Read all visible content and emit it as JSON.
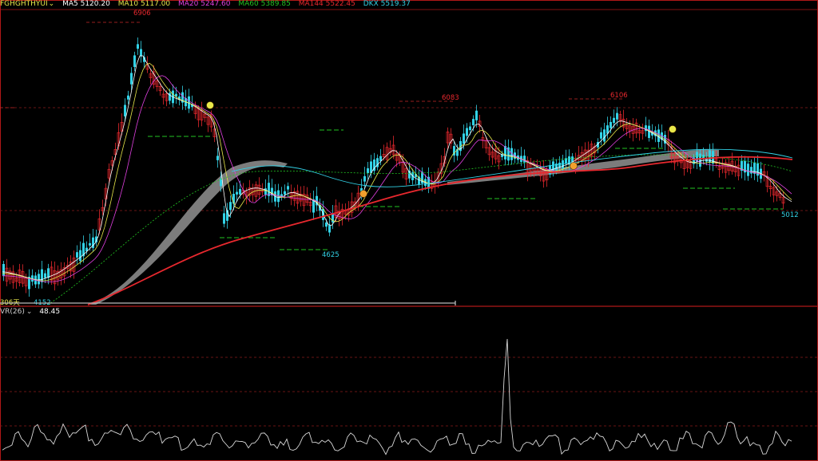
{
  "header": {
    "symbol": "FGHGHTHYUI",
    "indicators": [
      {
        "label": "MA5 5120.20",
        "color": "#ffffff"
      },
      {
        "label": "MA10 5117.00",
        "color": "#e8e84a"
      },
      {
        "label": "MA20 5247.60",
        "color": "#e040e0"
      },
      {
        "label": "MA60 5389.85",
        "color": "#22c422"
      },
      {
        "label": "MA144 5522.45",
        "color": "#e8282e"
      },
      {
        "label": "DKX 5519.37",
        "color": "#32d2e6"
      }
    ]
  },
  "annotations": {
    "high1": "6906",
    "high2": "6083",
    "high3": "6106",
    "low1": "4625",
    "low2": "5012",
    "low3": "4152",
    "left_edge": "306天"
  },
  "subchart": {
    "name": "VR(26)",
    "value": "48.45"
  },
  "colors": {
    "up": "#e8282e",
    "down": "#32d2e6",
    "grid": "#8a1a1a",
    "frame": "#b01818"
  },
  "chart_data": {
    "type": "candlestick",
    "series": [
      {
        "name": "MA5"
      },
      {
        "name": "MA10"
      },
      {
        "name": "MA20"
      },
      {
        "name": "MA60"
      },
      {
        "name": "MA144"
      },
      {
        "name": "DKX"
      }
    ],
    "highs_marked": [
      6906,
      6083,
      6106
    ],
    "lows_marked": [
      4625,
      5012,
      4152
    ]
  }
}
